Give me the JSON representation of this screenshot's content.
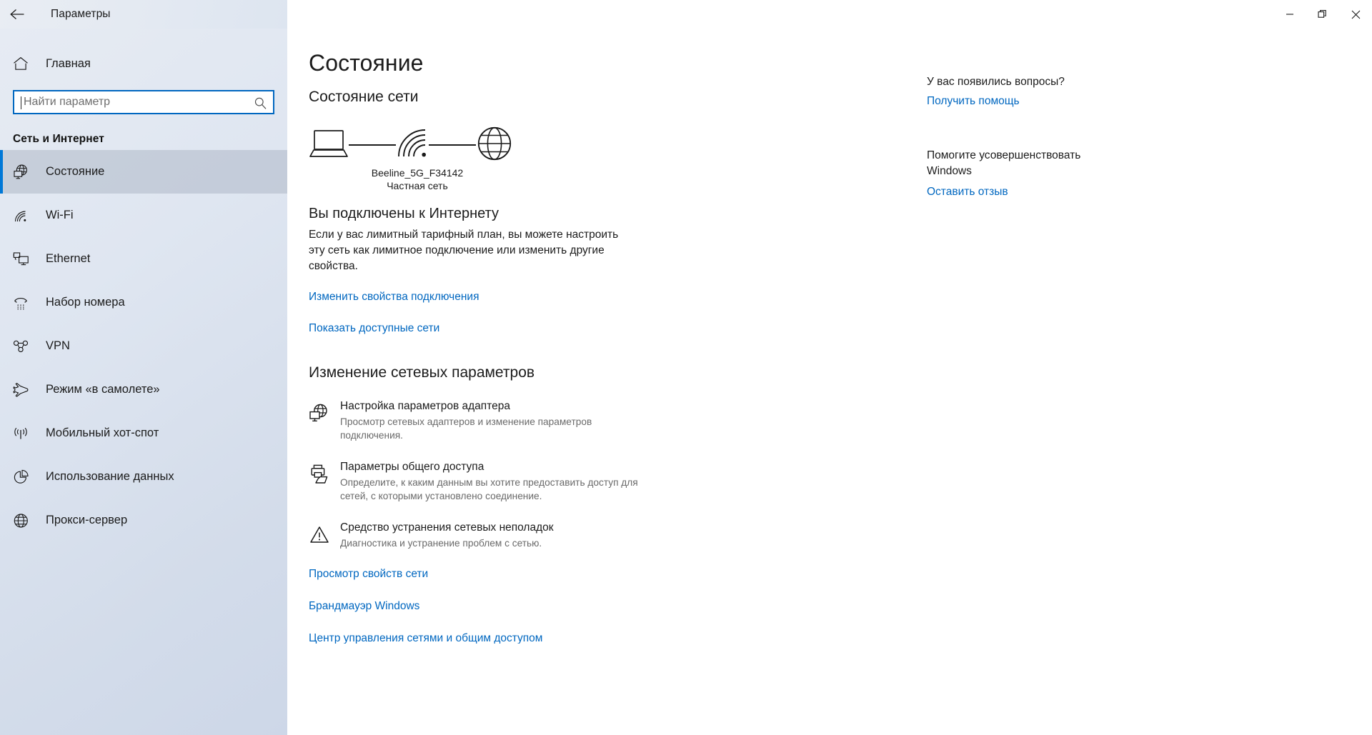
{
  "window": {
    "title": "Параметры",
    "back_icon": "back-arrow-icon",
    "controls": {
      "minimize": "minimize-icon",
      "maximize": "restore-icon",
      "close": "close-icon"
    }
  },
  "sidebar": {
    "home": {
      "label": "Главная",
      "icon": "home-icon"
    },
    "search": {
      "placeholder": "Найти параметр",
      "value": "",
      "icon": "search-icon"
    },
    "group_title": "Сеть и Интернет",
    "items": [
      {
        "label": "Состояние",
        "icon": "globe-monitor-icon",
        "selected": true
      },
      {
        "label": "Wi-Fi",
        "icon": "wifi-icon",
        "selected": false
      },
      {
        "label": "Ethernet",
        "icon": "ethernet-icon",
        "selected": false
      },
      {
        "label": "Набор номера",
        "icon": "dialup-phone-icon",
        "selected": false
      },
      {
        "label": "VPN",
        "icon": "vpn-icon",
        "selected": false
      },
      {
        "label": "Режим «в самолете»",
        "icon": "airplane-icon",
        "selected": false
      },
      {
        "label": "Мобильный хот-спот",
        "icon": "hotspot-icon",
        "selected": false
      },
      {
        "label": "Использование данных",
        "icon": "pie-chart-icon",
        "selected": false
      },
      {
        "label": "Прокси-сервер",
        "icon": "globe-icon",
        "selected": false
      }
    ]
  },
  "main": {
    "page_title": "Состояние",
    "network_status_heading": "Состояние сети",
    "diagram": {
      "device_icon": "laptop-icon",
      "connection_icon": "wifi-signal-icon",
      "internet_icon": "globe-icon",
      "ssid": "Beeline_5G_F34142",
      "network_type": "Частная сеть"
    },
    "connected_heading": "Вы подключены к Интернету",
    "connected_description": "Если у вас лимитный тарифный план, вы можете настроить эту сеть как лимитное подключение или изменить другие свойства.",
    "primary_links": [
      "Изменить свойства подключения",
      "Показать доступные сети"
    ],
    "change_settings_heading": "Изменение сетевых параметров",
    "options": [
      {
        "icon": "adapter-globe-icon",
        "title": "Настройка параметров адаптера",
        "description": "Просмотр сетевых адаптеров и изменение параметров подключения."
      },
      {
        "icon": "sharing-printer-folder-icon",
        "title": "Параметры общего доступа",
        "description": "Определите, к каким данным вы хотите предоставить доступ для сетей, с которыми установлено соединение."
      },
      {
        "icon": "warning-triangle-icon",
        "title": "Средство устранения сетевых неполадок",
        "description": "Диагностика и устранение проблем с сетью."
      }
    ],
    "bottom_links": [
      "Просмотр свойств сети",
      "Брандмауэр Windows"
    ],
    "clipped_link": "Центр управления сетями и общим доступом"
  },
  "help": {
    "questions_heading": "У вас появились вопросы?",
    "get_help_link": "Получить помощь",
    "improve_heading": "Помогите усовершенствовать Windows",
    "feedback_link": "Оставить отзыв"
  },
  "colors": {
    "accent": "#0078d7",
    "link": "#0067c0",
    "focus_border": "#0067c0",
    "text": "#1b1b1b",
    "muted_text": "#6a6a6a"
  }
}
